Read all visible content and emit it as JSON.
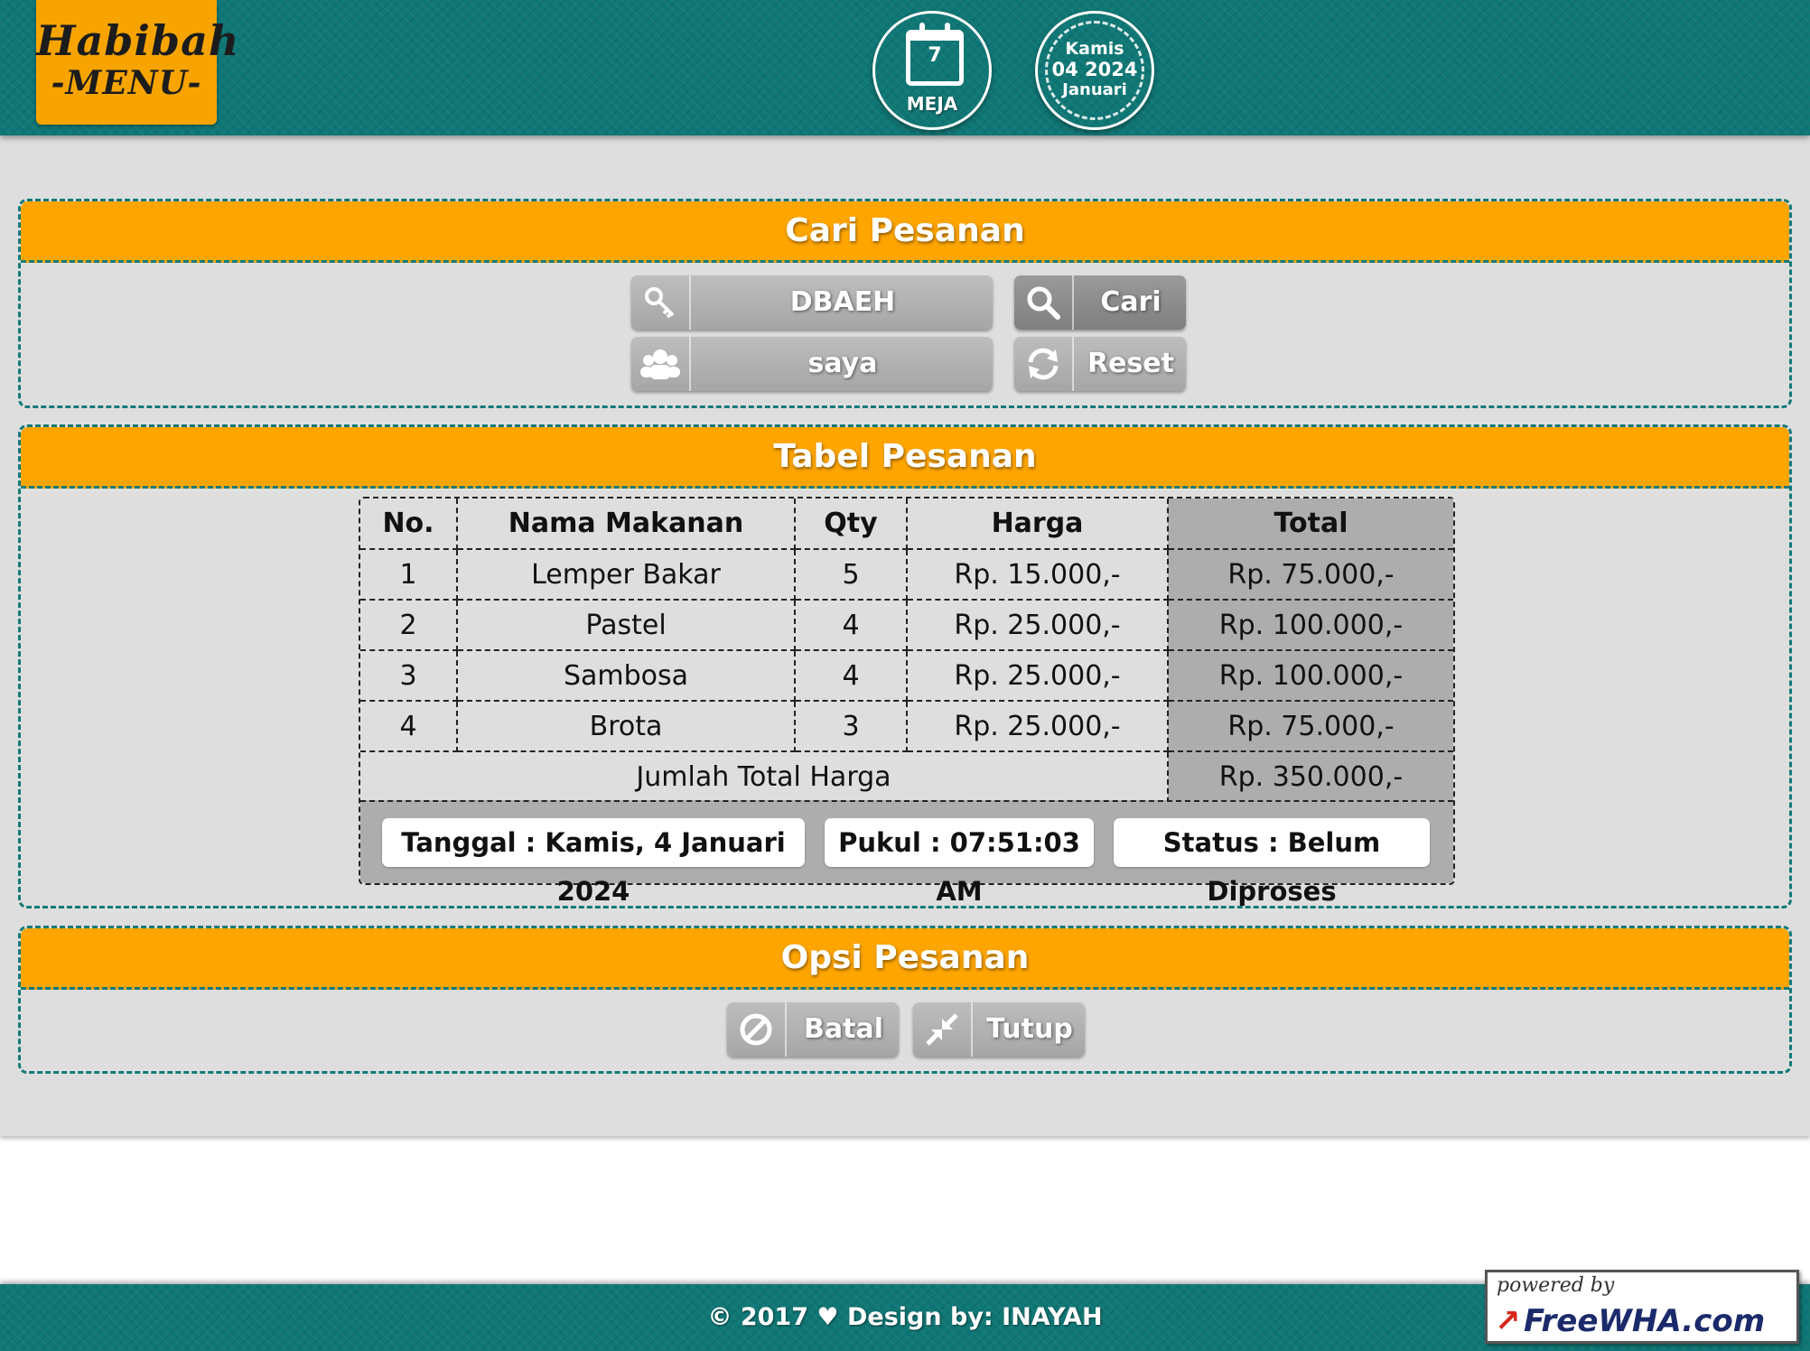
{
  "header": {
    "logo_top": "Habibah",
    "logo_bottom": "-MENU-",
    "table_number": "7",
    "table_label": "MEJA",
    "date_day": "Kamis",
    "date_mid": "04 2024",
    "date_month": "Januari"
  },
  "search_panel": {
    "title": "Cari Pesanan",
    "code_value": "DBAEH",
    "name_value": "saya",
    "search_label": "Cari",
    "reset_label": "Reset"
  },
  "order_panel": {
    "title": "Tabel Pesanan",
    "columns": [
      "No.",
      "Nama Makanan",
      "Qty",
      "Harga",
      "Total"
    ],
    "rows": [
      [
        "1",
        "Lemper Bakar",
        "5",
        "Rp. 15.000,-",
        "Rp. 75.000,-"
      ],
      [
        "2",
        "Pastel",
        "4",
        "Rp. 25.000,-",
        "Rp. 100.000,-"
      ],
      [
        "3",
        "Sambosa",
        "4",
        "Rp. 25.000,-",
        "Rp. 100.000,-"
      ],
      [
        "4",
        "Brota",
        "3",
        "Rp. 25.000,-",
        "Rp. 75.000,-"
      ]
    ],
    "total_label": "Jumlah Total Harga",
    "total_value": "Rp. 350.000,-",
    "date_info": "Tanggal : Kamis, 4 Januari 2024",
    "time_info": "Pukul : 07:51:03 AM",
    "status_info": "Status : Belum Diproses"
  },
  "options_panel": {
    "title": "Opsi Pesanan",
    "cancel_label": "Batal",
    "close_label": "Tutup"
  },
  "footer": {
    "text": "© 2017 ♥ Design by: INAYAH",
    "powered_top": "powered by",
    "powered_brand": "FreeWHA.com"
  },
  "colors": {
    "teal": "#0f7775",
    "orange": "#fea500",
    "logo_orange": "#f7a400",
    "panel_bg": "#dedede",
    "button_gray": "#adadad"
  },
  "icons": {
    "table_badge": "calendar-icon",
    "code_field": "key-icon",
    "name_field": "users-icon",
    "search_button": "search-icon",
    "reset_button": "refresh-icon",
    "cancel_button": "ban-icon",
    "close_button": "compress-icon"
  }
}
